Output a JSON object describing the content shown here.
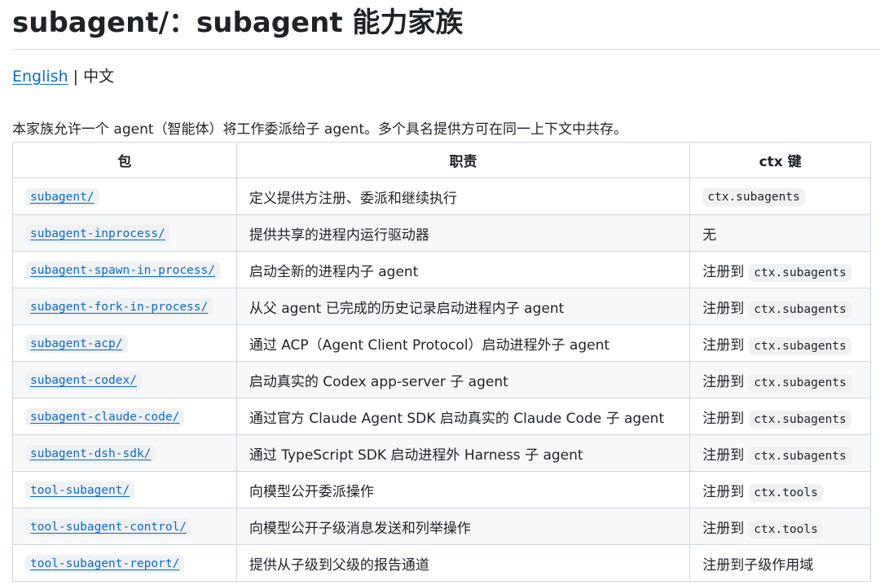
{
  "title": "subagent/：subagent 能力家族",
  "lang": {
    "english": "English",
    "separator": "|",
    "current": "中文"
  },
  "intro": "本家族允许一个 agent（智能体）将工作委派给子 agent。多个具名提供方可在同一上下文中共存。",
  "table": {
    "headers": [
      "包",
      "职责",
      "ctx 键"
    ],
    "rows": [
      {
        "pkg": "subagent/",
        "duty": "定义提供方注册、委派和继续执行",
        "ctx_text": "",
        "ctx_code": "ctx.subagents"
      },
      {
        "pkg": "subagent-inprocess/",
        "duty": "提供共享的进程内运行驱动器",
        "ctx_text": "无",
        "ctx_code": ""
      },
      {
        "pkg": "subagent-spawn-in-process/",
        "duty": "启动全新的进程内子 agent",
        "ctx_text": "注册到",
        "ctx_code": "ctx.subagents"
      },
      {
        "pkg": "subagent-fork-in-process/",
        "duty": "从父 agent 已完成的历史记录启动进程内子 agent",
        "ctx_text": "注册到",
        "ctx_code": "ctx.subagents"
      },
      {
        "pkg": "subagent-acp/",
        "duty": "通过 ACP（Agent Client Protocol）启动进程外子 agent",
        "ctx_text": "注册到",
        "ctx_code": "ctx.subagents"
      },
      {
        "pkg": "subagent-codex/",
        "duty": "启动真实的 Codex app-server 子 agent",
        "ctx_text": "注册到",
        "ctx_code": "ctx.subagents"
      },
      {
        "pkg": "subagent-claude-code/",
        "duty": "通过官方 Claude Agent SDK 启动真实的 Claude Code 子 agent",
        "ctx_text": "注册到",
        "ctx_code": "ctx.subagents"
      },
      {
        "pkg": "subagent-dsh-sdk/",
        "duty": "通过 TypeScript SDK 启动进程外 Harness 子 agent",
        "ctx_text": "注册到",
        "ctx_code": "ctx.subagents"
      },
      {
        "pkg": "tool-subagent/",
        "duty": "向模型公开委派操作",
        "ctx_text": "注册到",
        "ctx_code": "ctx.tools"
      },
      {
        "pkg": "tool-subagent-control/",
        "duty": "向模型公开子级消息发送和列举操作",
        "ctx_text": "注册到",
        "ctx_code": "ctx.tools"
      },
      {
        "pkg": "tool-subagent-report/",
        "duty": "提供从子级到父级的报告通道",
        "ctx_text": "注册到子级作用域",
        "ctx_code": ""
      }
    ]
  },
  "colors": {
    "link": "#0969da",
    "code_bg": "#eff1f3",
    "border": "#d0d7de",
    "row_alt": "#f6f8fa"
  }
}
